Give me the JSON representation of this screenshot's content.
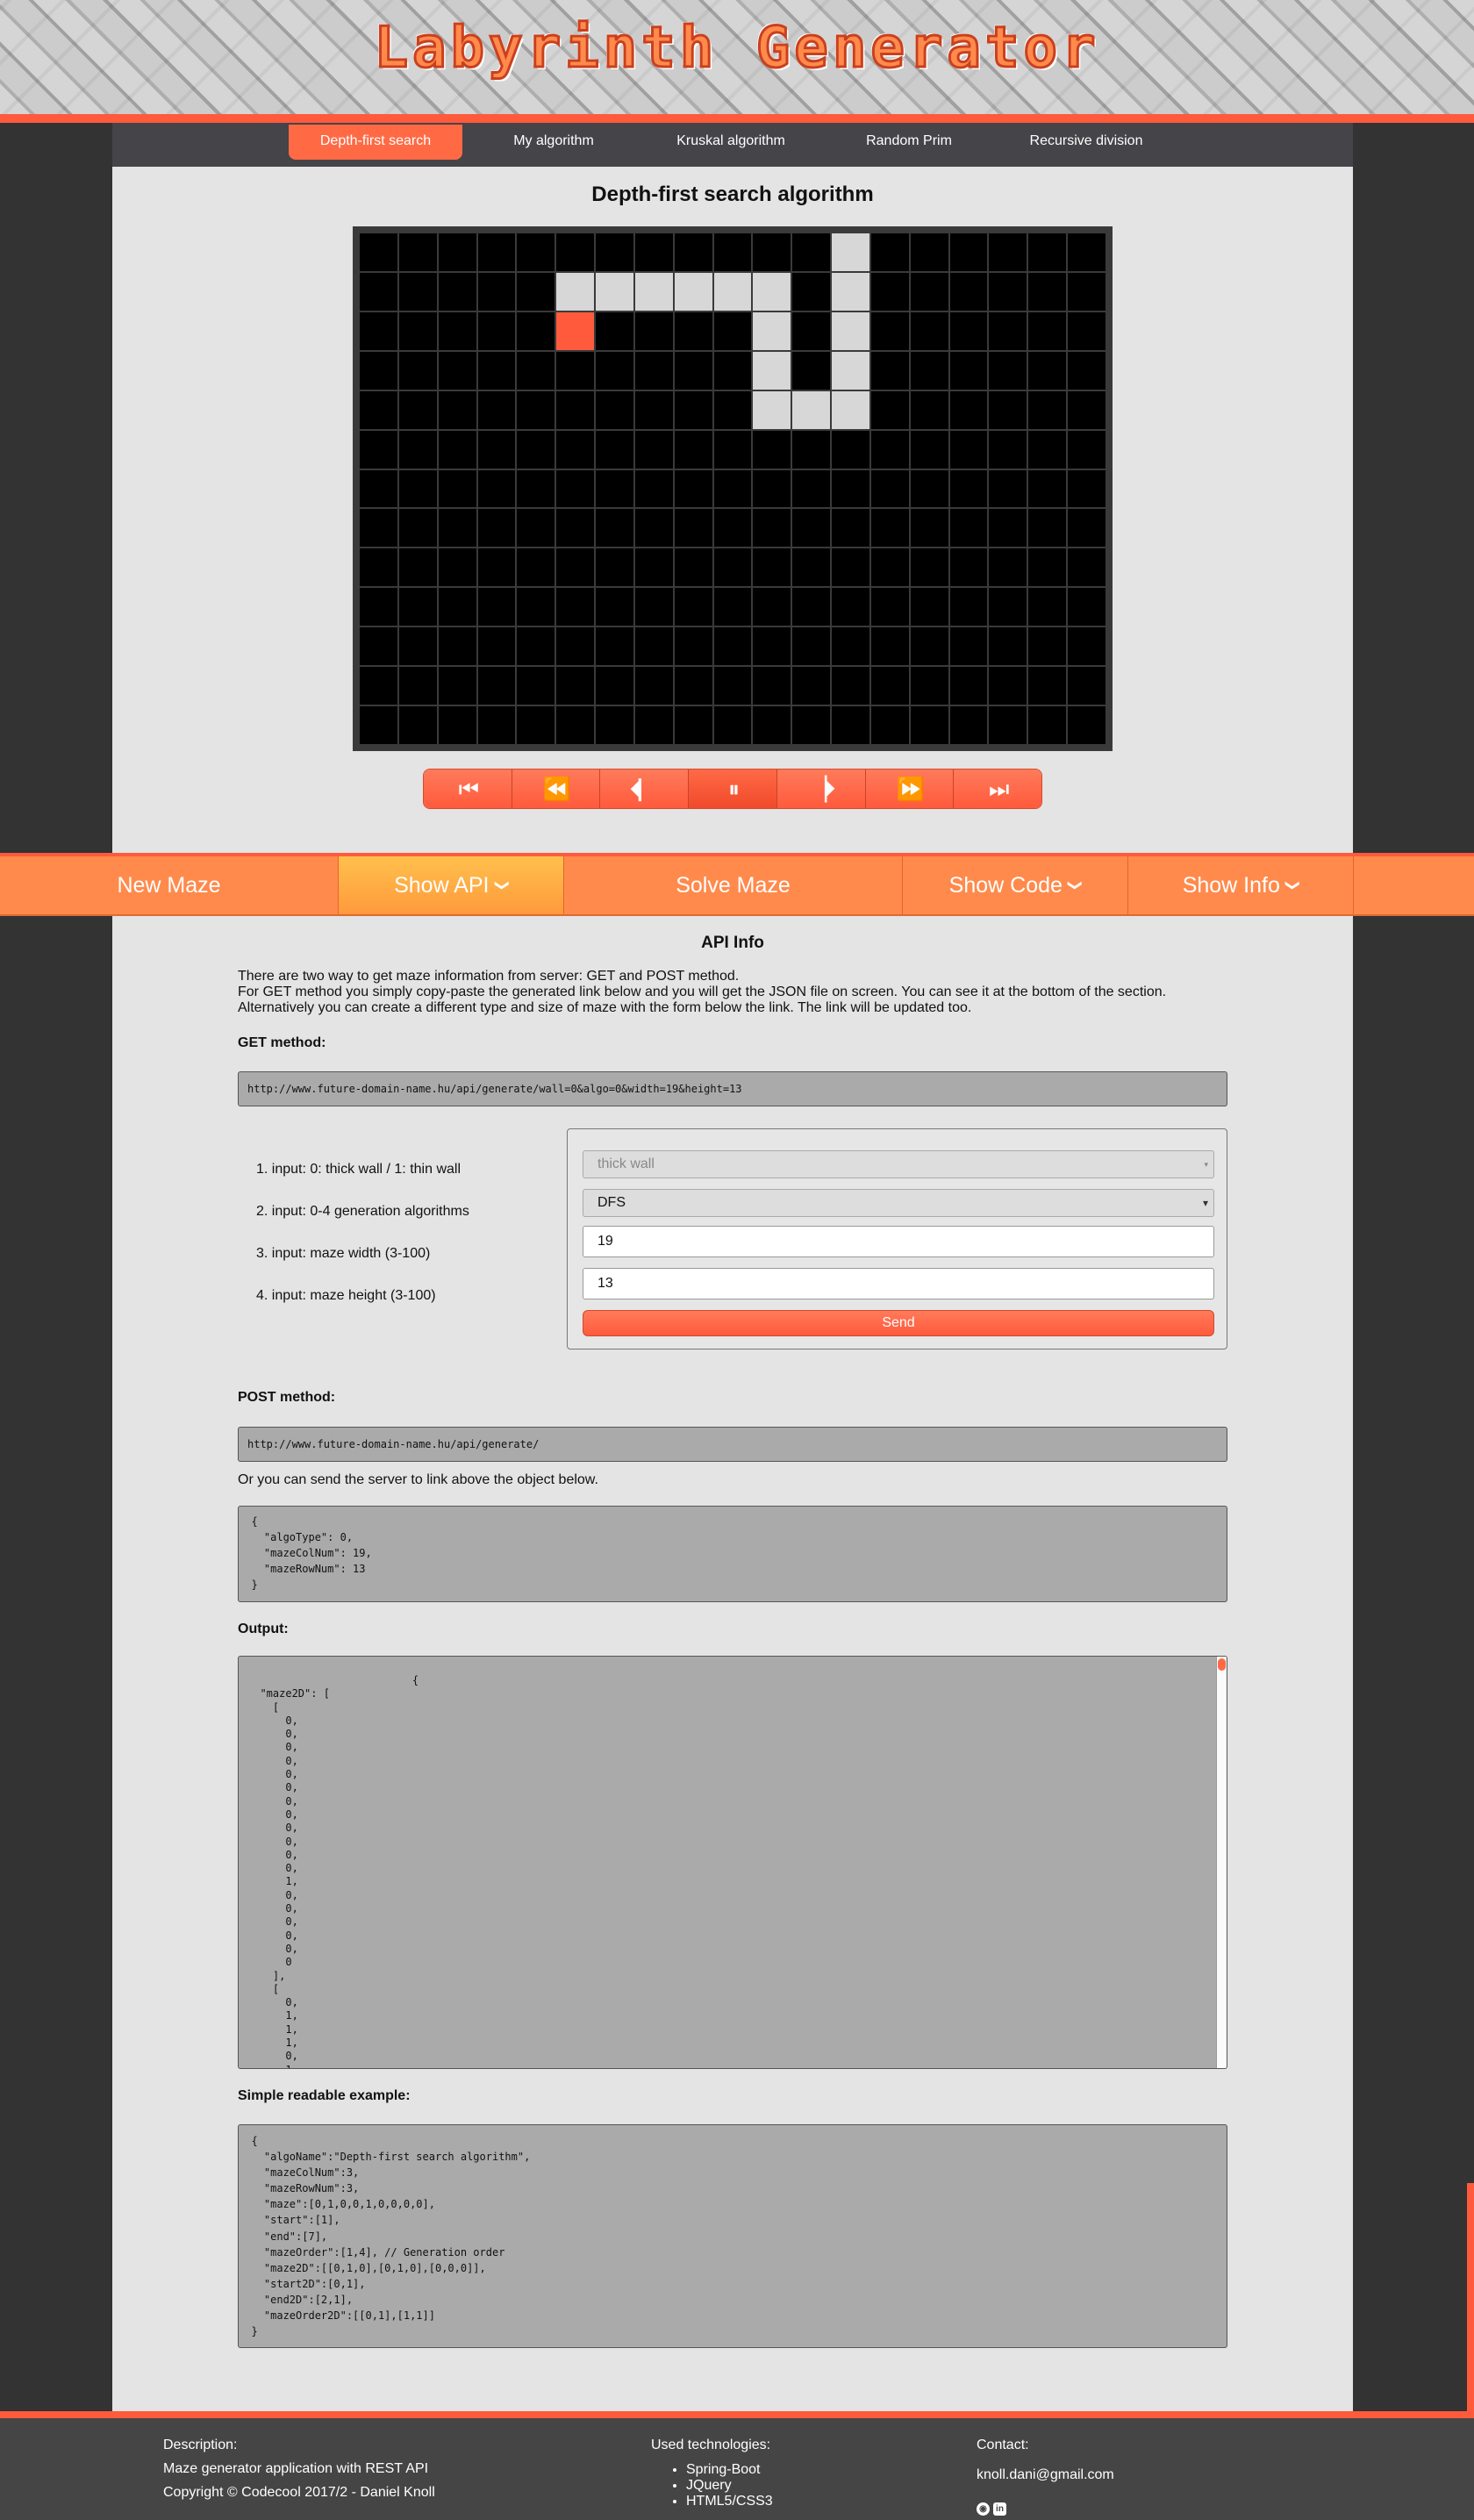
{
  "header": {
    "title": "Labyrinth Generator"
  },
  "nav": {
    "tabs": [
      {
        "label": "Depth-first search",
        "active": true
      },
      {
        "label": "My algorithm",
        "active": false
      },
      {
        "label": "Kruskal algorithm",
        "active": false
      },
      {
        "label": "Random Prim",
        "active": false
      },
      {
        "label": "Recursive division",
        "active": false
      }
    ]
  },
  "maze": {
    "title": "Depth-first search algorithm",
    "cols": 19,
    "rows": 13,
    "path_cells": [
      [
        0,
        12
      ],
      [
        1,
        5
      ],
      [
        1,
        6
      ],
      [
        1,
        7
      ],
      [
        1,
        8
      ],
      [
        1,
        9
      ],
      [
        1,
        10
      ],
      [
        1,
        12
      ],
      [
        2,
        10
      ],
      [
        2,
        12
      ],
      [
        3,
        10
      ],
      [
        3,
        12
      ],
      [
        4,
        10
      ],
      [
        4,
        11
      ],
      [
        4,
        12
      ]
    ],
    "current_cell": [
      2,
      5
    ],
    "colors": {
      "wall": "#000000",
      "path": "#d7d7d7",
      "current": "#ff5a3c"
    }
  },
  "player": {
    "buttons": [
      {
        "name": "first-step-button",
        "icon": "⏮",
        "active": false
      },
      {
        "name": "rewind-button",
        "icon": "⏪",
        "active": false
      },
      {
        "name": "step-back-button",
        "icon": "⏴▏",
        "active": false
      },
      {
        "name": "pause-button",
        "icon": "⏸",
        "active": true
      },
      {
        "name": "step-forward-button",
        "icon": "▕⏵",
        "active": false
      },
      {
        "name": "fast-forward-button",
        "icon": "⏩",
        "active": false
      },
      {
        "name": "last-step-button",
        "icon": "⏭",
        "active": false
      }
    ]
  },
  "actions": {
    "new_maze": "New Maze",
    "show_api": "Show API",
    "solve_maze": "Solve Maze",
    "show_code": "Show Code",
    "show_info": "Show Info",
    "chevron": "❯"
  },
  "api": {
    "title": "API Info",
    "intro": [
      "There are two way to get maze information from server: GET and POST method.",
      "For GET method you simply copy-paste the generated link below and you will get the JSON file on screen. You can see it at the bottom of the section.",
      "Alternatively you can create a different type and size of maze with the form below the link. The link will be updated too."
    ],
    "get_heading": "GET method:",
    "get_url": "http://www.future-domain-name.hu/api/generate/wall=0&algo=0&width=19&height=13",
    "inputs": [
      "1. input: 0: thick wall / 1: thin wall",
      "2. input: 0-4 generation algorithms",
      "3. input: maze width (3-100)",
      "4. input: maze height (3-100)"
    ],
    "form": {
      "wall": "thick wall",
      "algo": "DFS",
      "width": "19",
      "height": "13",
      "send": "Send"
    },
    "post_heading": "POST method:",
    "post_url": "http://www.future-domain-name.hu/api/generate/",
    "post_note": "Or you can send the server to link above the object below.",
    "post_body": "  {\n    \"algoType\": 0,\n    \"mazeColNum\": 19,\n    \"mazeRowNum\": 13\n  }",
    "output_heading": "Output:",
    "output_text": "                          {\n  \"maze2D\": [\n    [\n      0,\n      0,\n      0,\n      0,\n      0,\n      0,\n      0,\n      0,\n      0,\n      0,\n      0,\n      0,\n      1,\n      0,\n      0,\n      0,\n      0,\n      0,\n      0\n    ],\n    [\n      0,\n      1,\n      1,\n      1,\n      0,\n      1,",
    "example_heading": "Simple readable example:",
    "example_text": "  {\n    \"algoName\":\"Depth-first search algorithm\",\n    \"mazeColNum\":3,\n    \"mazeRowNum\":3,\n    \"maze\":[0,1,0,0,1,0,0,0,0],\n    \"start\":[1],\n    \"end\":[7],\n    \"mazeOrder\":[1,4], // Generation order\n    \"maze2D\":[[0,1,0],[0,1,0],[0,0,0]],\n    \"start2D\":[0,1],\n    \"end2D\":[2,1],\n    \"mazeOrder2D\":[[0,1],[1,1]]\n  }"
  },
  "footer": {
    "description_heading": "Description:",
    "description": "Maze generator application with REST API",
    "copyright": "Copyright © Codecool 2017/2 - Daniel Knoll",
    "tech_heading": "Used technologies:",
    "technologies": [
      "Spring-Boot",
      "JQuery",
      "HTML5/CSS3"
    ],
    "contact_heading": "Contact:",
    "email": "knoll.dani@gmail.com",
    "social_icons": [
      "github-icon",
      "linkedin-icon"
    ]
  },
  "colors": {
    "accent": "#ff5a3c",
    "accent_light": "#ff8a4c",
    "highlight": "#ffb347",
    "panel": "#444449",
    "background": "#e4e4e4"
  }
}
